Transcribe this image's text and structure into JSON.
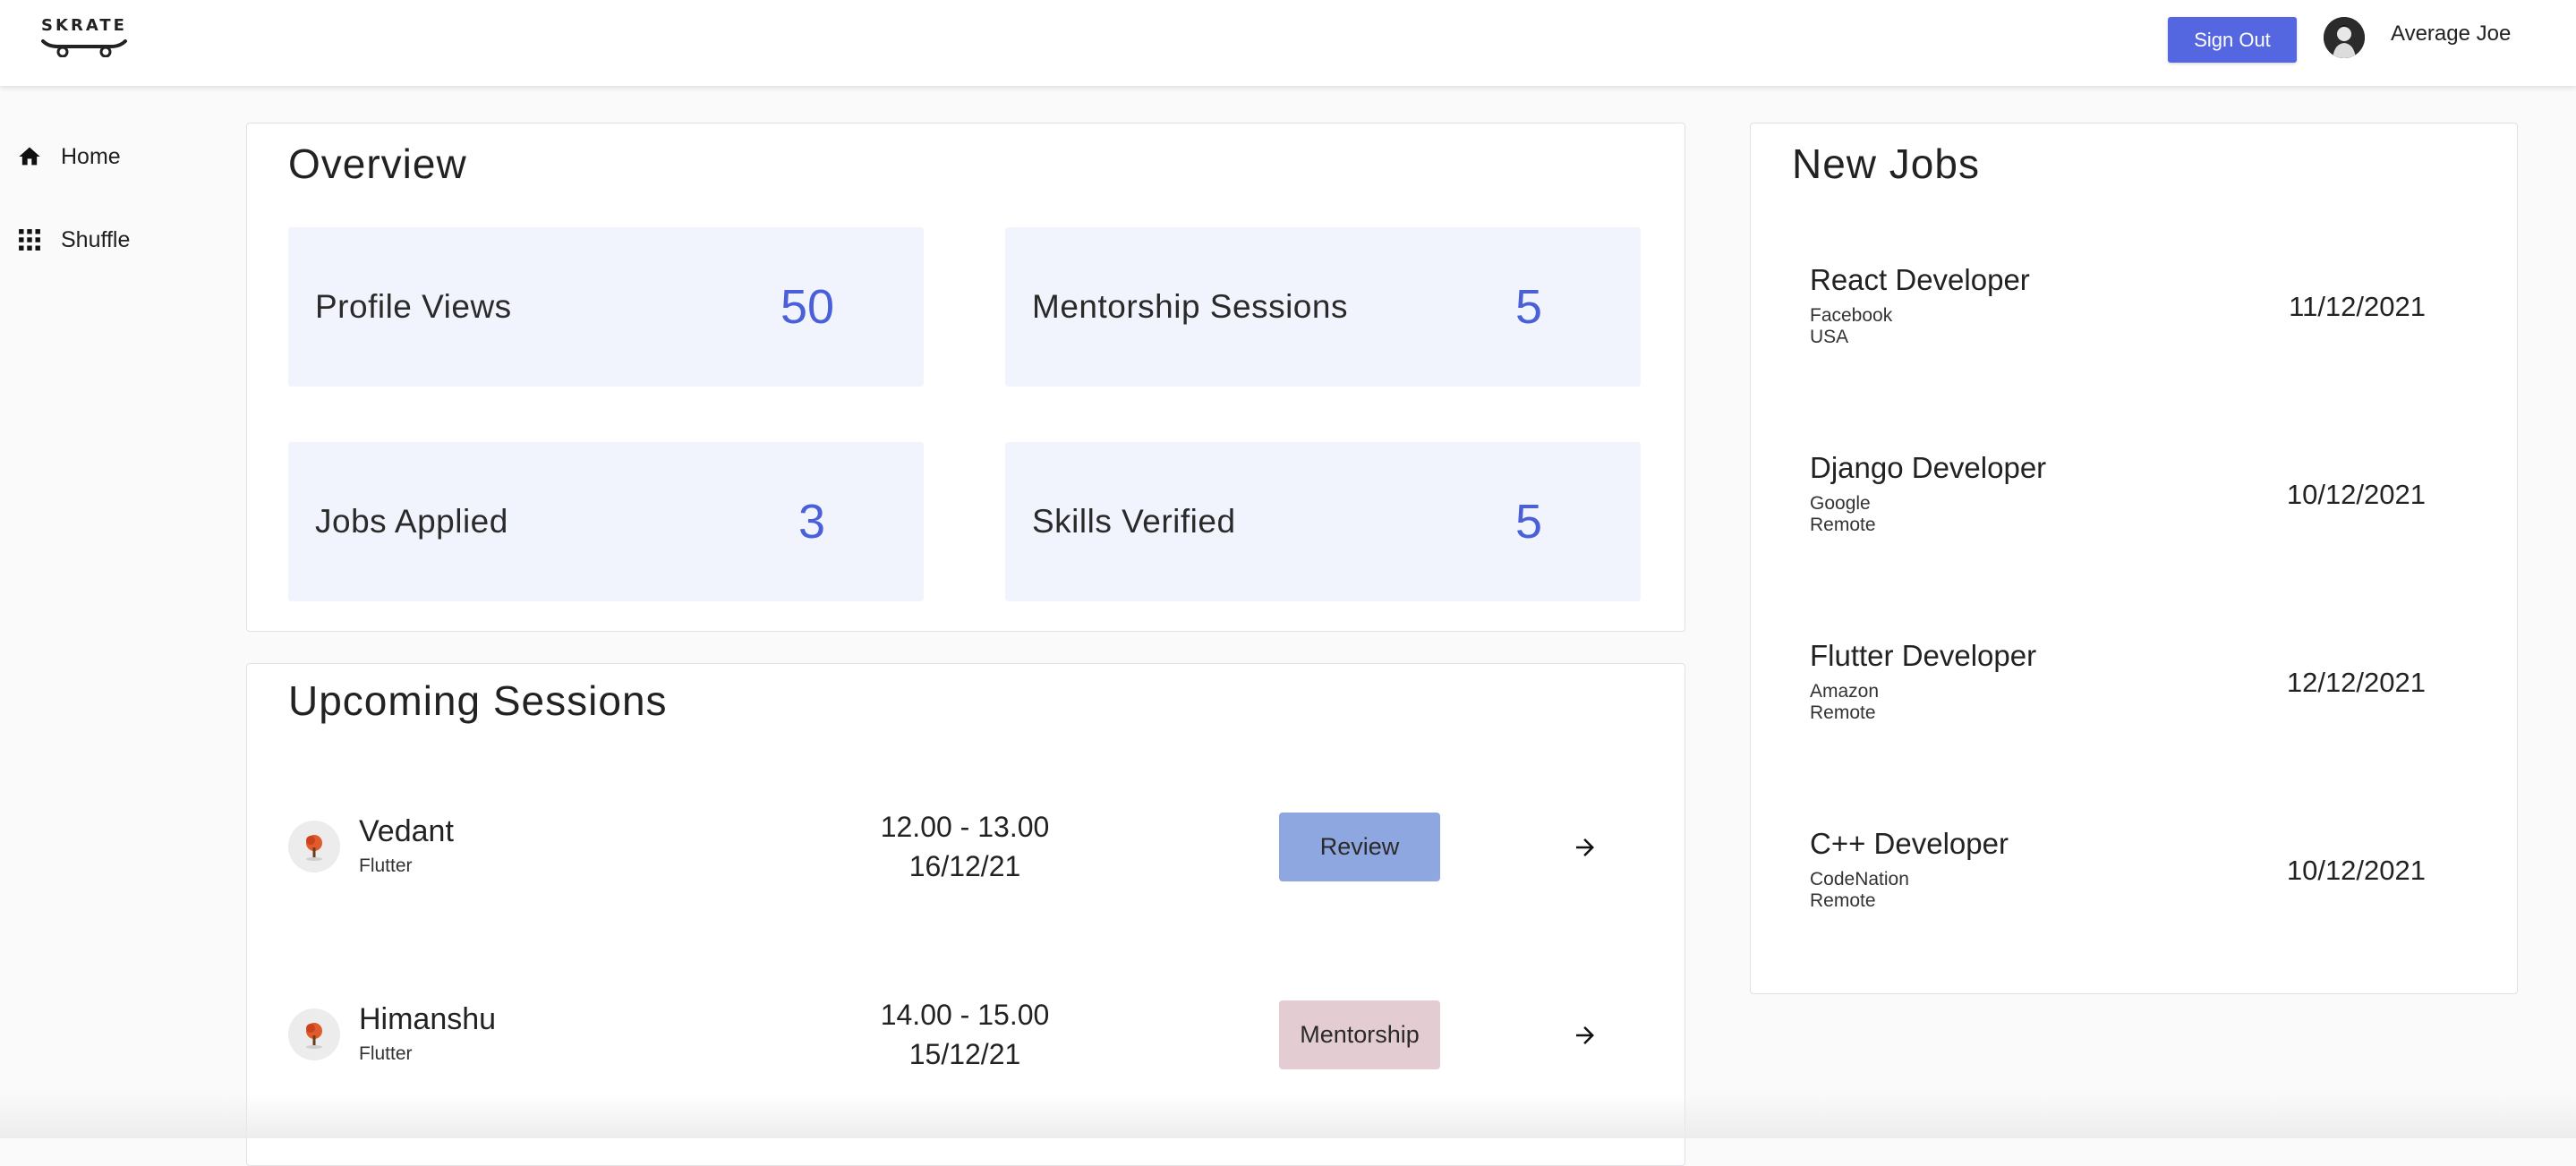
{
  "header": {
    "logo_text": "SKRATE",
    "signout_label": "Sign Out",
    "user_name": "Average Joe",
    "accent_color": "#5466e0"
  },
  "sidebar": {
    "items": [
      {
        "label": "Home",
        "icon": "home-icon"
      },
      {
        "label": "Shuffle",
        "icon": "grid-icon"
      }
    ]
  },
  "overview": {
    "title": "Overview",
    "stats": [
      {
        "label": "Profile Views",
        "value": "50"
      },
      {
        "label": "Mentorship Sessions",
        "value": "5"
      },
      {
        "label": "Jobs Applied",
        "value": "3"
      },
      {
        "label": "Skills Verified",
        "value": "5"
      }
    ],
    "value_color": "#4a60d8"
  },
  "sessions": {
    "title": "Upcoming Sessions",
    "items": [
      {
        "name": "Vedant",
        "skill": "Flutter",
        "time": "12.00 - 13.00",
        "date": "16/12/21",
        "action": "Review",
        "action_color": "#8fa7e0",
        "icon": "arrow-right-icon"
      },
      {
        "name": "Himanshu",
        "skill": "Flutter",
        "time": "14.00 - 15.00",
        "date": "15/12/21",
        "action": "Mentorship",
        "action_color": "#e4ccd3",
        "icon": "arrow-right-icon"
      }
    ]
  },
  "jobs": {
    "title": "New Jobs",
    "items": [
      {
        "title": "React Developer",
        "company": "Facebook",
        "location": "USA",
        "date": "11/12/2021"
      },
      {
        "title": "Django Developer",
        "company": "Google",
        "location": "Remote",
        "date": "10/12/2021"
      },
      {
        "title": "Flutter Developer",
        "company": "Amazon",
        "location": "Remote",
        "date": "12/12/2021"
      },
      {
        "title": "C++ Developer",
        "company": "CodeNation",
        "location": "Remote",
        "date": "10/12/2021"
      }
    ]
  }
}
